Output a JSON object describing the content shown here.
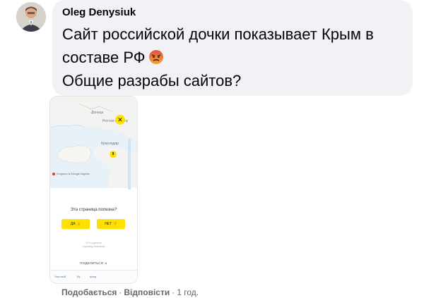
{
  "comment": {
    "author": "Oleg Denysiuk",
    "lines": [
      "Сайт российской дочки показывает Крым в",
      "составе РФ",
      "Общие разрабы сайтов?"
    ],
    "reaction_emoji": "angry-face-emoji"
  },
  "attachment": {
    "map_labels": {
      "top": "Донецк",
      "right": "Ростов-на-Дону",
      "mid": "Краснодар"
    },
    "map_pins": [
      "✕",
      "9"
    ],
    "google_badge": "Открыть в Google Картах",
    "feedback_question": "Эта страница полезна?",
    "yes_label": "ДА 👍",
    "no_label": "НЕТ 👎",
    "note_line1": "97% оценили",
    "note_line2": "страницу полезной",
    "share_label": "ПОДЕЛИТЬСЯ",
    "bottom_bar": [
      "Частный",
      "Бу",
      "Кред"
    ]
  },
  "actions": {
    "like": "Подобається",
    "reply": "Відповісти",
    "time": "1 год.",
    "separator": "·"
  },
  "colors": {
    "bubble": "#f0f2f5",
    "accent_yellow": "#ffe100",
    "meta_text": "#65676b"
  }
}
